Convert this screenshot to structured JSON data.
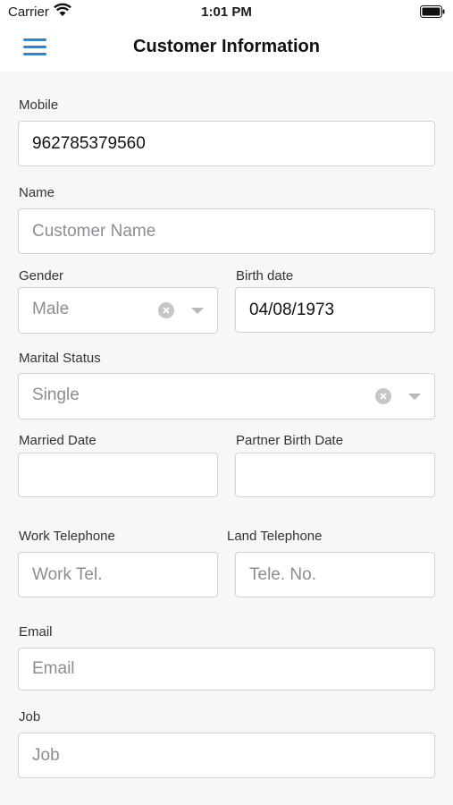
{
  "status_bar": {
    "carrier": "Carrier",
    "time": "1:01 PM"
  },
  "navbar": {
    "title": "Customer Information"
  },
  "form": {
    "mobile": {
      "label": "Mobile",
      "value": "962785379560",
      "placeholder": ""
    },
    "name": {
      "label": "Name",
      "value": "",
      "placeholder": "Customer Name"
    },
    "gender": {
      "label": "Gender",
      "value": "Male"
    },
    "birth_date": {
      "label": "Birth date",
      "value": "04/08/1973",
      "placeholder": ""
    },
    "marital_status": {
      "label": "Marital Status",
      "value": "Single"
    },
    "married_date": {
      "label": "Married Date",
      "value": "",
      "placeholder": ""
    },
    "partner_birth_date": {
      "label": "Partner Birth Date",
      "value": "",
      "placeholder": ""
    },
    "work_telephone": {
      "label": "Work Telephone",
      "value": "",
      "placeholder": "Work Tel."
    },
    "land_telephone": {
      "label": "Land Telephone",
      "value": "",
      "placeholder": "Tele. No."
    },
    "email": {
      "label": "Email",
      "value": "",
      "placeholder": "Email"
    },
    "job": {
      "label": "Job",
      "value": "",
      "placeholder": "Job"
    }
  },
  "icons": {
    "menu": "hamburger-menu-icon",
    "wifi": "wifi-icon",
    "battery": "battery-icon",
    "clear": "clear-circle-icon",
    "chevron": "chevron-down-icon"
  },
  "colors": {
    "accent": "#1e88e5",
    "background": "#f7f7f8",
    "border": "#cfd3d8"
  }
}
